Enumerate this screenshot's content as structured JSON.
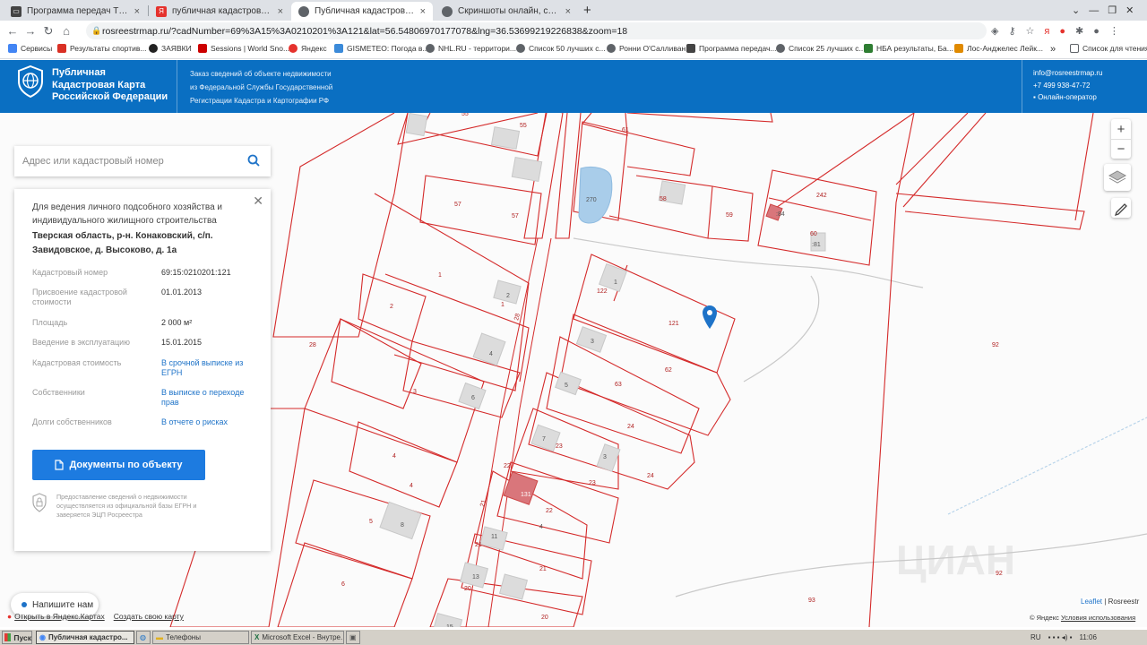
{
  "browser": {
    "tabs": [
      {
        "label": "Программа передач ТВ — Яндекс",
        "active": false
      },
      {
        "label": "публичная кадастровая карта твер",
        "active": false
      },
      {
        "label": "Публичная кадастровая карта",
        "active": true
      },
      {
        "label": "Скриншоты онлайн, сервис получ",
        "active": false
      }
    ],
    "url": "rosreestrmap.ru/?cadNumber=69%3A15%3A0210201%3A121&lat=56.54806970177078&lng=36.53699219226838&zoom=18",
    "bookmarks": [
      "Сервисы",
      "Результаты спортив...",
      "ЗАЯВКИ",
      "Sessions | World Sno...",
      "Яндекс",
      "GISMETEO: Погода в...",
      "NHL.RU - территори...",
      "Список 50 лучших с...",
      "Ронни О'Салливан",
      "Программа передач...",
      "Список 25 лучших с...",
      "НБА результаты, Ба...",
      "Лос-Анджелес Лейк..."
    ],
    "reading_list": "Список для чтения",
    "more": "»"
  },
  "header": {
    "brand_lines": [
      "Публичная",
      "Кадастровая Карта",
      "Российской Федерации"
    ],
    "info_lines": [
      "Заказ сведений об объекте недвижимости",
      "из Федеральной Службы Государственной",
      "Регистрации Кадастра и Картографии РФ"
    ],
    "email": "info@rosreestrmap.ru",
    "phone": "+7 499 938-47-72",
    "operator": "Онлайн-оператор"
  },
  "search": {
    "placeholder": "Адрес или кадастровый номер"
  },
  "card": {
    "purpose": "Для ведения личного подсобного хозяйства и индивидуального жилищного строительства",
    "address": "Тверская область, р-н. Конаковский, с/п. Завидовское, д. Высоково, д. 1а",
    "rows": [
      {
        "key": "Кадастровый номер",
        "value": "69:15:0210201:121",
        "link": false
      },
      {
        "key": "Присвоение кадастровой стоимости",
        "value": "01.01.2013",
        "link": false
      },
      {
        "key": "Площадь",
        "value": "2 000 м²",
        "link": false
      },
      {
        "key": "Введение в эксплуатацию",
        "value": "15.01.2015",
        "link": false
      },
      {
        "key": "Кадастровая стоимость",
        "value": "В срочной выписке из ЕГРН",
        "link": true
      },
      {
        "key": "Собственники",
        "value": "В выписке о переходе прав",
        "link": true
      },
      {
        "key": "Долги собственников",
        "value": "В отчете о рисках",
        "link": true
      }
    ],
    "button": "Документы по объекту",
    "note": "Предоставление сведений о недвижимости осуществляется из официальной базы ЕГРН и заверяется ЭЦП Росреестра"
  },
  "map": {
    "labels": [
      "55",
      "55",
      "61",
      "57",
      "57",
      "270",
      "58",
      "59",
      "242",
      "60",
      ":81",
      ":84",
      "1",
      "2",
      "1",
      "2",
      "28",
      "122",
      "1",
      "121",
      "28",
      "3",
      "4",
      "4",
      "3",
      "62",
      "6",
      "63",
      "5",
      "92",
      "24",
      "7",
      "23",
      "24",
      "3",
      "4",
      "23",
      "22",
      "22",
      "21",
      "4",
      "131",
      "5",
      "8",
      "11",
      "21",
      "21",
      "13",
      "20",
      "6",
      "20",
      "15",
      "92",
      "93"
    ],
    "watermark": "ЦИАН"
  },
  "controls": {
    "zoom_in": "+",
    "zoom_out": "−"
  },
  "chat": {
    "label": "Напишите нам"
  },
  "yandex": {
    "open": "Открыть в Яндекс.Картах",
    "create": "Создать свою карту"
  },
  "attribution": {
    "leaflet": "Leaflet",
    "rosreestr": "Rosreestr",
    "yandex": "© Яндекс",
    "terms": "Условия использования"
  },
  "taskbar": {
    "start": "Пуск",
    "tasks": [
      "Публичная кадастро...",
      "",
      "Телефоны",
      "Microsoft Excel - Внутре...",
      ""
    ],
    "lang": "RU",
    "time": "11:06"
  },
  "colors": {
    "header": "#0a6fc2",
    "parcel_line": "#d42a2a",
    "button": "#1d7be0",
    "link": "#1e73c8"
  }
}
